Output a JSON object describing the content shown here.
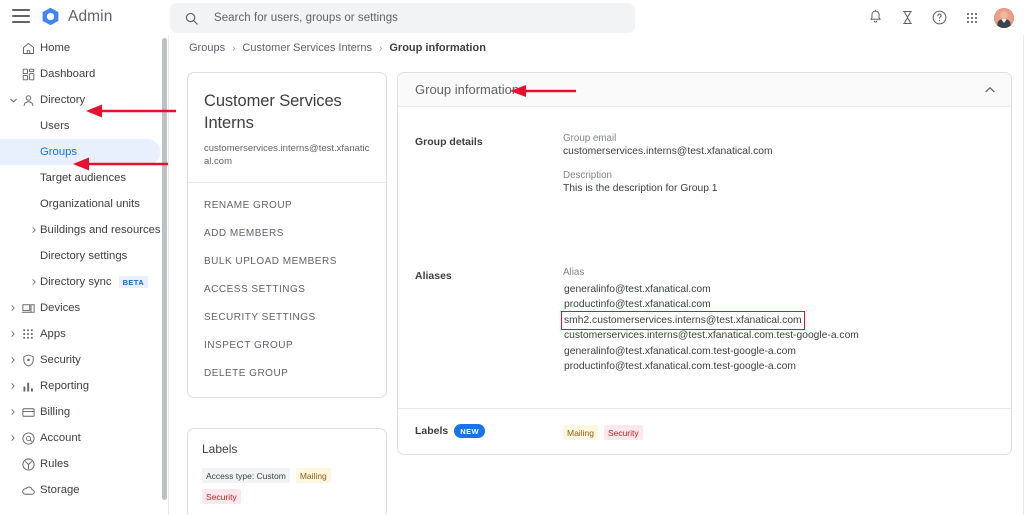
{
  "topbar": {
    "menu_icon": "hamburger-menu-icon",
    "brand": "Admin",
    "brand_logo_icon": "google-admin-hexagon-logo",
    "search": {
      "placeholder": "Search for users, groups or settings",
      "value": "",
      "icon": "search-icon"
    },
    "actions": [
      {
        "name": "notifications-icon",
        "glyph": "bell"
      },
      {
        "name": "hourglass-icon",
        "glyph": "hourglass"
      },
      {
        "name": "help-icon",
        "glyph": "question-circle"
      },
      {
        "name": "apps-grid-icon",
        "glyph": "grid"
      },
      {
        "name": "avatar",
        "glyph": "user-photo"
      }
    ]
  },
  "sidebar": {
    "items": [
      {
        "label": "Home",
        "icon": "home-icon",
        "level": 0,
        "expandable": false,
        "selected": false
      },
      {
        "label": "Dashboard",
        "icon": "dashboard-icon",
        "level": 0,
        "expandable": false,
        "selected": false
      },
      {
        "label": "Directory",
        "icon": "directory-person-icon",
        "level": 0,
        "expandable": true,
        "expanded": true,
        "selected": false
      },
      {
        "label": "Users",
        "icon": "",
        "level": 1,
        "expandable": false,
        "selected": false
      },
      {
        "label": "Groups",
        "icon": "",
        "level": 1,
        "expandable": false,
        "selected": true
      },
      {
        "label": "Target audiences",
        "icon": "",
        "level": 1,
        "expandable": false,
        "selected": false
      },
      {
        "label": "Organizational units",
        "icon": "",
        "level": 1,
        "expandable": false,
        "selected": false
      },
      {
        "label": "Buildings and resources",
        "icon": "",
        "level": 1,
        "expandable": true,
        "expanded": false,
        "selected": false
      },
      {
        "label": "Directory settings",
        "icon": "",
        "level": 1,
        "expandable": false,
        "selected": false
      },
      {
        "label": "Directory sync",
        "icon": "",
        "level": 1,
        "expandable": true,
        "expanded": false,
        "selected": false,
        "badge": "BETA"
      },
      {
        "label": "Devices",
        "icon": "devices-icon",
        "level": 0,
        "expandable": true,
        "expanded": false,
        "selected": false
      },
      {
        "label": "Apps",
        "icon": "apps-grid-icon",
        "level": 0,
        "expandable": true,
        "expanded": false,
        "selected": false
      },
      {
        "label": "Security",
        "icon": "shield-icon",
        "level": 0,
        "expandable": true,
        "expanded": false,
        "selected": false
      },
      {
        "label": "Reporting",
        "icon": "bar-chart-icon",
        "level": 0,
        "expandable": true,
        "expanded": false,
        "selected": false
      },
      {
        "label": "Billing",
        "icon": "credit-card-icon",
        "level": 0,
        "expandable": true,
        "expanded": false,
        "selected": false
      },
      {
        "label": "Account",
        "icon": "at-sign-icon",
        "level": 0,
        "expandable": true,
        "expanded": false,
        "selected": false
      },
      {
        "label": "Rules",
        "icon": "rules-icon",
        "level": 0,
        "expandable": false,
        "selected": false
      },
      {
        "label": "Storage",
        "icon": "cloud-icon",
        "level": 0,
        "expandable": false,
        "selected": false
      }
    ]
  },
  "breadcrumb": [
    {
      "label": "Groups",
      "current": false
    },
    {
      "label": "Customer Services Interns",
      "current": false
    },
    {
      "label": "Group information",
      "current": true
    }
  ],
  "group_card": {
    "title": "Customer Services Interns",
    "email": "customerservices.interns@test.xfanatical.com",
    "actions": [
      "RENAME GROUP",
      "ADD MEMBERS",
      "BULK UPLOAD MEMBERS",
      "ACCESS SETTINGS",
      "SECURITY SETTINGS",
      "INSPECT GROUP",
      "DELETE GROUP"
    ]
  },
  "labels_card": {
    "title": "Labels",
    "chips": [
      {
        "text": "Access type: Custom",
        "style": "grey"
      },
      {
        "text": "Mailing",
        "style": "yellow"
      },
      {
        "text": "Security",
        "style": "pink"
      }
    ]
  },
  "group_information": {
    "header": "Group information",
    "collapse_icon": "chevron-up-icon",
    "group_details": {
      "section_label": "Group details",
      "email_label": "Group email",
      "email_value": "customerservices.interns@test.xfanatical.com",
      "description_label": "Description",
      "description_value": "This is the description for Group 1"
    },
    "aliases": {
      "section_label": "Aliases",
      "column_label": "Alias",
      "items": [
        {
          "value": "generalinfo@test.xfanatical.com",
          "highlighted": false
        },
        {
          "value": "productinfo@test.xfanatical.com",
          "highlighted": false
        },
        {
          "value": "smh2.customerservices.interns@test.xfanatical.com",
          "highlighted": true
        },
        {
          "value": "customerservices.interns@test.xfanatical.com.test-google-a.com",
          "highlighted": false
        },
        {
          "value": "generalinfo@test.xfanatical.com.test-google-a.com",
          "highlighted": false
        },
        {
          "value": "productinfo@test.xfanatical.com.test-google-a.com",
          "highlighted": false
        }
      ]
    },
    "labels": {
      "section_label": "Labels",
      "badge": "NEW",
      "chips": [
        {
          "text": "Mailing",
          "style": "yellow"
        },
        {
          "text": "Security",
          "style": "pink"
        }
      ]
    }
  },
  "annotations": {
    "arrow_color": "#e8112d",
    "arrows": [
      {
        "name": "arrow-to-directory",
        "target": "Directory"
      },
      {
        "name": "arrow-to-groups",
        "target": "Groups"
      },
      {
        "name": "arrow-to-group-information",
        "target": "Group information"
      }
    ],
    "highlight_box": {
      "name": "alias-highlight-box",
      "target": "smh2.customerservices.interns@test.xfanatical.com",
      "color": "#e8112d"
    }
  },
  "colors": {
    "accent": "#1a73e8",
    "selected_bg": "#e8f0fe",
    "annotation_red": "#e8112d",
    "text_primary": "#3c4043",
    "text_secondary": "#5f6368"
  }
}
